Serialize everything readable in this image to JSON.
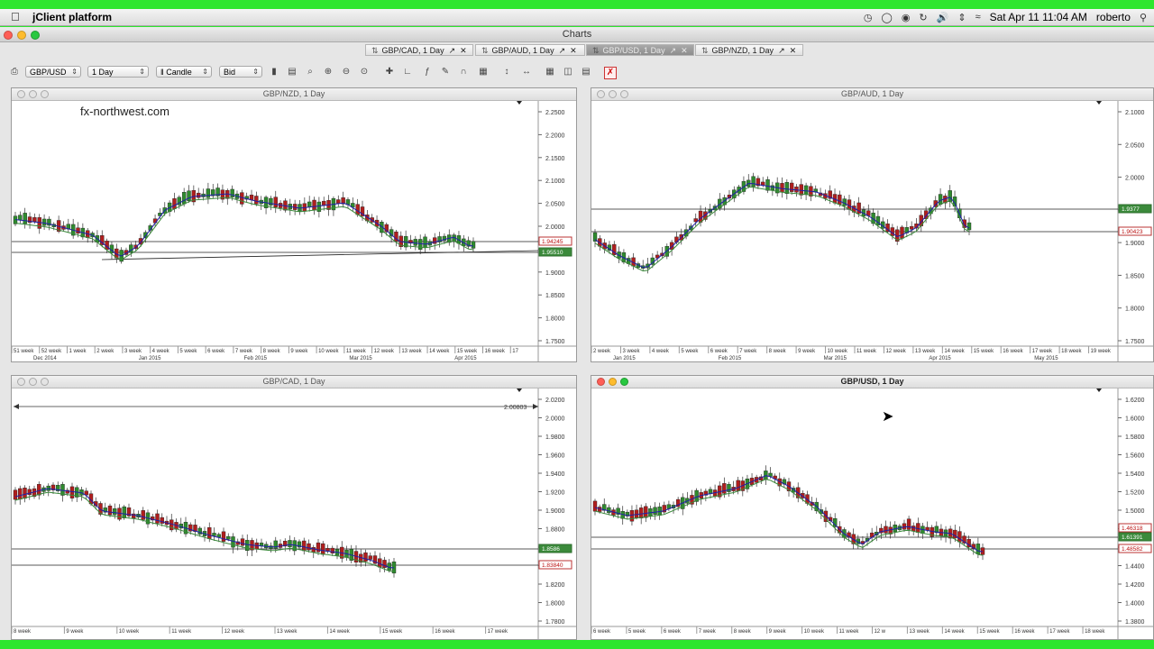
{
  "menubar": {
    "app_name": "jClient platform",
    "date_time": "Sat Apr 11  11:04 AM",
    "user": "roberto"
  },
  "window": {
    "title": "Charts"
  },
  "tabs": [
    {
      "label": "GBP/CAD, 1 Day",
      "active": false
    },
    {
      "label": "GBP/AUD, 1 Day",
      "active": false
    },
    {
      "label": "GBP/USD, 1 Day",
      "active": true
    },
    {
      "label": "GBP/NZD, 1 Day",
      "active": false
    }
  ],
  "toolbar": {
    "instrument": "GBP/USD",
    "period": "1 Day",
    "chart_type": "Candle",
    "side": "Bid"
  },
  "colors": {
    "up": "#2e8b2e",
    "down": "#b01e1e",
    "ma_slow": "#1f1fa8",
    "ma_fast": "#3a8a3a"
  },
  "panels": [
    {
      "title": "GBP/NZD, 1 Day",
      "watermark": "fx-northwest.com",
      "active": false,
      "y_ticks": [
        "2.2500",
        "2.2000",
        "2.1500",
        "2.1000",
        "2.0500",
        "2.0000",
        "1.9500",
        "1.9000",
        "1.8500",
        "1.8000",
        "1.7500"
      ],
      "price_labels": [
        "1.95510",
        "1.94245"
      ],
      "week_labels": [
        "51 week",
        "52 week",
        "1 week",
        "2 week",
        "3 week",
        "4 week",
        "5 week",
        "6 week",
        "7 week",
        "8 week",
        "9 week",
        "10 week",
        "11 week",
        "12 week",
        "13 week",
        "14 week",
        "15 week",
        "16 week",
        "17"
      ],
      "month_labels": [
        "Dec 2014",
        "Jan 2015",
        "Feb 2015",
        "Mar 2015",
        "Apr 2015"
      ]
    },
    {
      "title": "GBP/AUD, 1 Day",
      "active": false,
      "y_ticks": [
        "2.1000",
        "2.0500",
        "2.0000",
        "1.9500",
        "1.9000",
        "1.8500",
        "1.8000",
        "1.7500"
      ],
      "price_labels": [
        "1.9377",
        "1.90423"
      ],
      "week_labels": [
        "2 week",
        "3 week",
        "4 week",
        "5 week",
        "6 week",
        "7 week",
        "8 week",
        "9 week",
        "10 week",
        "11 week",
        "12 week",
        "13 week",
        "14 week",
        "15 week",
        "16 week",
        "17 week",
        "18 week",
        "19 week"
      ],
      "month_labels": [
        "Jan 2015",
        "Feb 2015",
        "Mar 2015",
        "Apr 2015",
        "May 2015"
      ]
    },
    {
      "title": "GBP/CAD, 1 Day",
      "active": false,
      "y_ticks": [
        "2.0200",
        "2.0000",
        "1.9800",
        "1.9600",
        "1.9400",
        "1.9200",
        "1.9000",
        "1.8800",
        "1.8600",
        "1.8400",
        "1.8200",
        "1.8000",
        "1.7800"
      ],
      "price_labels": [
        "1.8586",
        "1.83840"
      ],
      "range_label": "2.00803",
      "week_labels": [
        "8 week",
        "9 week",
        "10 week",
        "11 week",
        "12 week",
        "13 week",
        "14 week",
        "15 week",
        "16 week",
        "17 week"
      ],
      "month_labels": []
    },
    {
      "title": "GBP/USD, 1 Day",
      "active": true,
      "y_ticks": [
        "1.6200",
        "1.6000",
        "1.5800",
        "1.5600",
        "1.5400",
        "1.5200",
        "1.5000",
        "1.4800",
        "1.4600",
        "1.4400",
        "1.4200",
        "1.4000",
        "1.3800"
      ],
      "price_labels": [
        "1.61391",
        "1.48582",
        "1.46318"
      ],
      "week_labels": [
        "6 week",
        "5 week",
        "6 week",
        "7 week",
        "8 week",
        "9 week",
        "10 week",
        "11 week",
        "12 w",
        "13 week",
        "14 week",
        "15 week",
        "16 week",
        "17 week",
        "18 week"
      ],
      "month_labels": []
    }
  ]
}
